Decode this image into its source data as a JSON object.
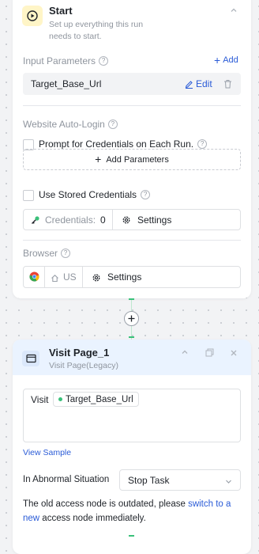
{
  "start_node": {
    "title": "Start",
    "subtitle": "Set up everything this run needs to start.",
    "input_parameters": {
      "label": "Input Parameters",
      "add_label": "Add",
      "param_name": "Target_Base_Url",
      "edit_label": "Edit"
    },
    "auto_login": {
      "label": "Website Auto-Login",
      "prompt_checkbox_label": "Prompt for Credentials on Each Run.",
      "add_parameters_label": "Add Parameters",
      "stored_checkbox_label": "Use Stored Credentials",
      "credentials_label": "Credentials:",
      "credentials_count": "0",
      "settings_label": "Settings"
    },
    "browser": {
      "label": "Browser",
      "region": "US",
      "settings_label": "Settings"
    }
  },
  "visit_node": {
    "title": "Visit Page_1",
    "subtitle": "Visit Page(Legacy)",
    "visit_prefix": "Visit",
    "param_chip": "Target_Base_Url",
    "view_sample": "View Sample",
    "abnormal_label": "In Abnormal Situation",
    "abnormal_value": "Stop Task",
    "notice_before": "The old access node is outdated, please ",
    "notice_link": "switch to a new",
    "notice_after": " access node immediately."
  },
  "colors": {
    "accent": "#2a5bd7",
    "start_icon_bg": "#fff5c7",
    "visit_header_bg": "#eaf3ff",
    "connector": "#3ac17a"
  }
}
